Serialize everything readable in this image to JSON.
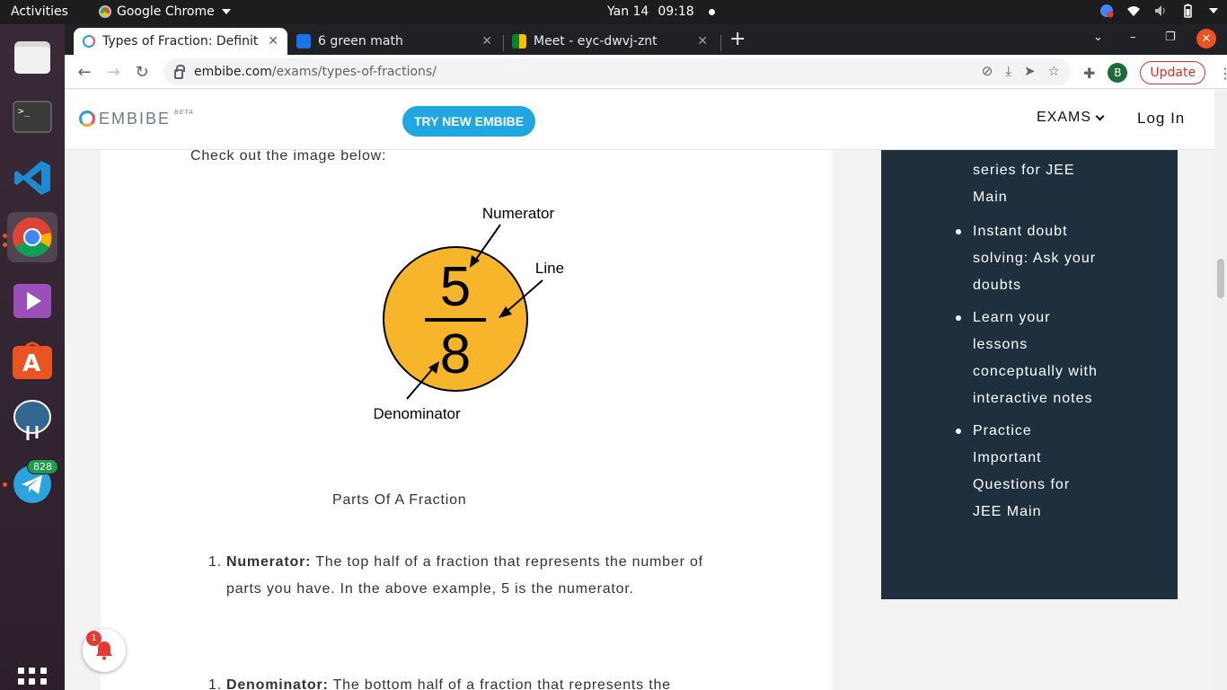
{
  "system": {
    "activities": "Activities",
    "app_name": "Google Chrome",
    "date": "Yan 14",
    "time": "09:18"
  },
  "dock": {
    "items": [
      "files",
      "terminal",
      "vscode",
      "chrome",
      "media-player",
      "app-center",
      "postgres",
      "telegram"
    ],
    "telegram_badge": "828"
  },
  "browser": {
    "tabs": [
      {
        "title": "Types of Fraction: Definit",
        "icon": "embibe-favicon"
      },
      {
        "title": "6 green math",
        "icon": "classroom-favicon"
      },
      {
        "title": "Meet - eyc-dwvj-znt",
        "icon": "meet-favicon"
      }
    ],
    "url_host": "embibe.com",
    "url_path": "/exams/types-of-fractions/",
    "profile_initial": "B",
    "update_label": "Update"
  },
  "site": {
    "logo_text": "EMBIBE",
    "logo_beta": "BETA",
    "try_button": "TRY NEW EMBIBE",
    "exams_label": "EXAMS",
    "login_label": "Log In"
  },
  "article": {
    "intro": "Check out the image below:",
    "figure": {
      "numerator_value": "5",
      "denominator_value": "8",
      "label_numerator": "Numerator",
      "label_line": "Line",
      "label_denominator": "Denominator",
      "circle_color": "#f7b52c"
    },
    "caption": "Parts Of A Fraction",
    "items": [
      {
        "num": "1.",
        "term": "Numerator:",
        "line1": "The top half of a fraction that represents the number of",
        "line2": "parts you have. In the above example, 5 is the numerator."
      },
      {
        "num": "1.",
        "term": "Denominator:",
        "line1": "The bottom half of a fraction that represents the"
      }
    ]
  },
  "sidebar": {
    "partial_top": "series for JEE",
    "partial_top2": "Main",
    "items": [
      {
        "l1": "Instant doubt",
        "l2": "solving: Ask your",
        "l3": "doubts"
      },
      {
        "l1": "Learn your",
        "l2": "lessons",
        "l3": "conceptually with",
        "l4": "interactive notes"
      },
      {
        "l1": "Practice",
        "l2": "Important",
        "l3": "Questions for",
        "l4": "JEE Main"
      }
    ]
  },
  "notification": {
    "count": "1"
  }
}
